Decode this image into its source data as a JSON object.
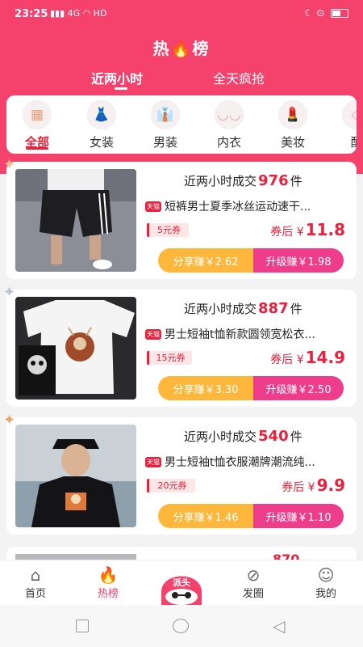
{
  "status": {
    "time": "23:25",
    "signal": "4G",
    "hd": "HD"
  },
  "header": {
    "title": "热🔥榜"
  },
  "tabs": [
    {
      "label": "近两小时"
    },
    {
      "label": "全天疯抢"
    }
  ],
  "categories": [
    {
      "label": "全部",
      "icon": "grid-icon"
    },
    {
      "label": "女装",
      "icon": "dress-icon"
    },
    {
      "label": "男装",
      "icon": "shirt-icon"
    },
    {
      "label": "内衣",
      "icon": "bra-icon"
    },
    {
      "label": "美妆",
      "icon": "lipstick-icon"
    },
    {
      "label": "配",
      "icon": "accessory-icon"
    }
  ],
  "products": [
    {
      "recent_prefix": "近两小时成交",
      "count": "976",
      "unit": "件",
      "tmall": "天猫",
      "name": "短裤男士夏季冰丝运动速干...",
      "coupon": "5元券",
      "after_label": "券后 ¥",
      "price": "11.8",
      "share": "分享赚￥2.62",
      "upgrade": "升级赚￥1.98"
    },
    {
      "recent_prefix": "近两小时成交",
      "count": "887",
      "unit": "件",
      "tmall": "天猫",
      "name": "男士短袖t恤新款圆领宽松衣...",
      "coupon": "15元券",
      "after_label": "券后 ¥",
      "price": "14.9",
      "share": "分享赚￥3.30",
      "upgrade": "升级赚￥2.50"
    },
    {
      "recent_prefix": "近两小时成交",
      "count": "540",
      "unit": "件",
      "tmall": "天猫",
      "name": "男士短袖t恤衣服潮牌潮流纯...",
      "coupon": "20元券",
      "after_label": "券后 ¥",
      "price": "9.9",
      "share": "分享赚￥1.46",
      "upgrade": "升级赚￥1.10"
    }
  ],
  "peek": {
    "count": "870"
  },
  "bottom_nav": [
    {
      "label": "首页",
      "icon": "home-icon"
    },
    {
      "label": "热榜",
      "icon": "flame-icon"
    },
    {
      "label": "派头",
      "icon": "paitou-mascot-icon"
    },
    {
      "label": "发圈",
      "icon": "compass-icon"
    },
    {
      "label": "我的",
      "icon": "profile-icon"
    }
  ],
  "colors": {
    "brand": "#f4426c",
    "price": "#e8213d",
    "share": "#fdb83c",
    "upgrade": "#ee3d8a"
  }
}
